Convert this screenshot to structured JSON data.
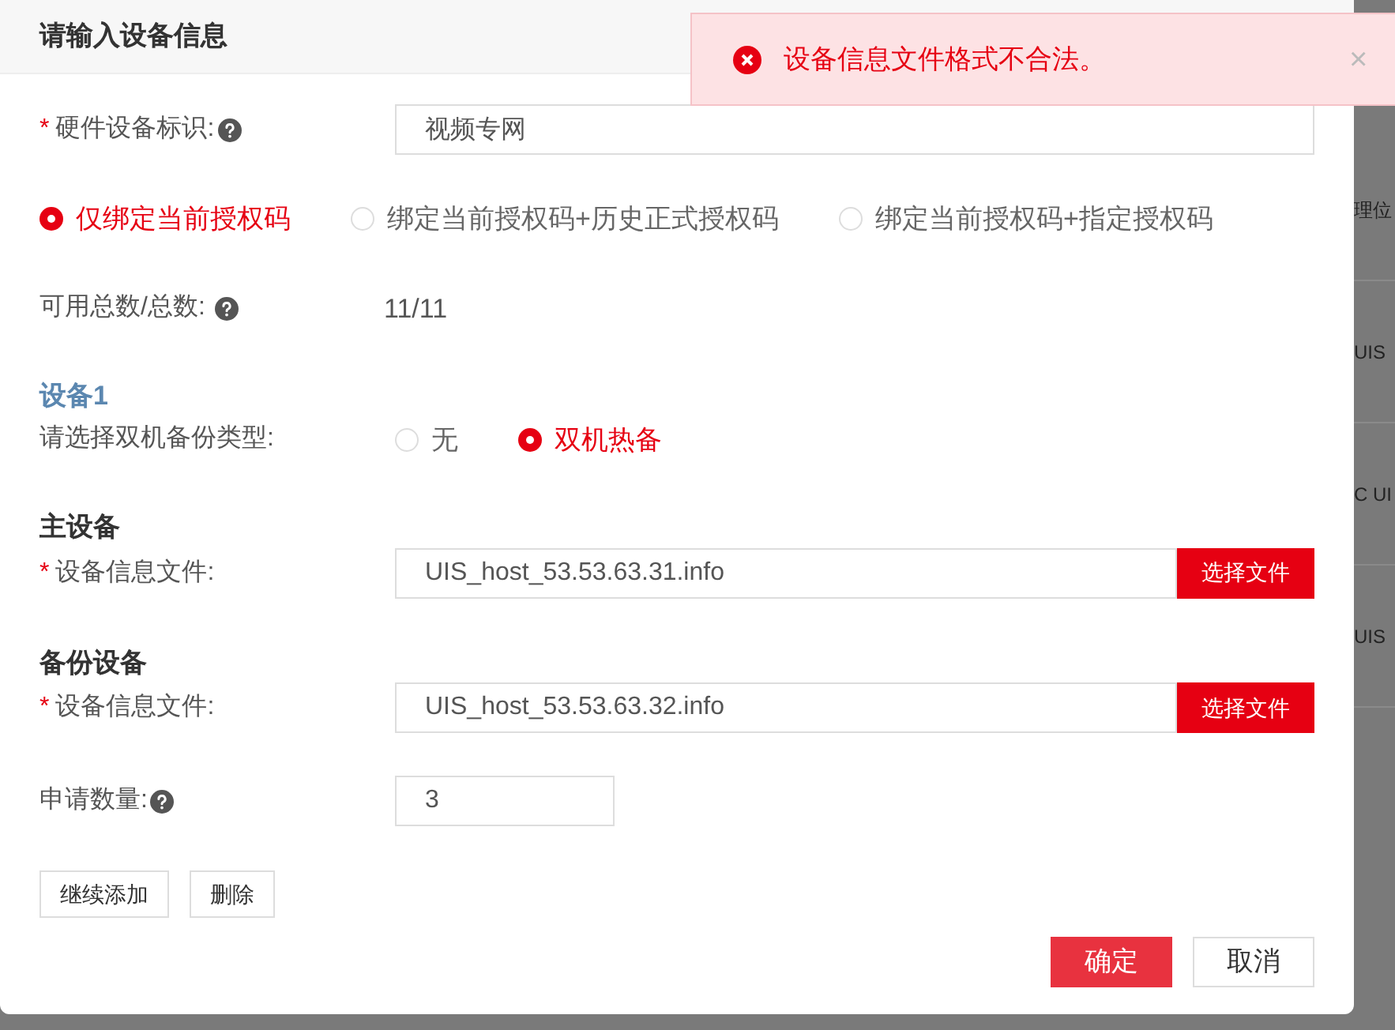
{
  "dialog": {
    "title": "请输入设备信息"
  },
  "toast": {
    "message": "设备信息文件格式不合法。",
    "close": "×"
  },
  "hardware_id": {
    "label": "硬件设备标识:",
    "marker": "*",
    "value": "视频专网"
  },
  "bind_options": [
    {
      "label": "仅绑定当前授权码",
      "selected": true
    },
    {
      "label": "绑定当前授权码+历史正式授权码",
      "selected": false
    },
    {
      "label": "绑定当前授权码+指定授权码",
      "selected": false
    }
  ],
  "available": {
    "label": "可用总数/总数:",
    "value": "11/11"
  },
  "device": {
    "title": "设备1",
    "backup_label": "请选择双机备份类型:",
    "backup_options": [
      {
        "label": "无",
        "selected": false
      },
      {
        "label": "双机热备",
        "selected": true
      }
    ],
    "sections": [
      {
        "title": "主设备",
        "label": "设备信息文件:",
        "marker": "*",
        "value": "UIS_host_53.53.63.31.info",
        "button": "选择文件"
      },
      {
        "title": "备份设备",
        "label": "设备信息文件:",
        "marker": "*",
        "value": "UIS_host_53.53.63.32.info",
        "button": "选择文件"
      }
    ]
  },
  "quantity": {
    "label": "申请数量:",
    "value": "3"
  },
  "row_buttons": [
    "继续添加",
    "删除"
  ],
  "footer": {
    "confirm": "确定",
    "cancel": "取消"
  },
  "background_texts": [
    "理位",
    "UIS",
    "C UI",
    "UIS"
  ]
}
